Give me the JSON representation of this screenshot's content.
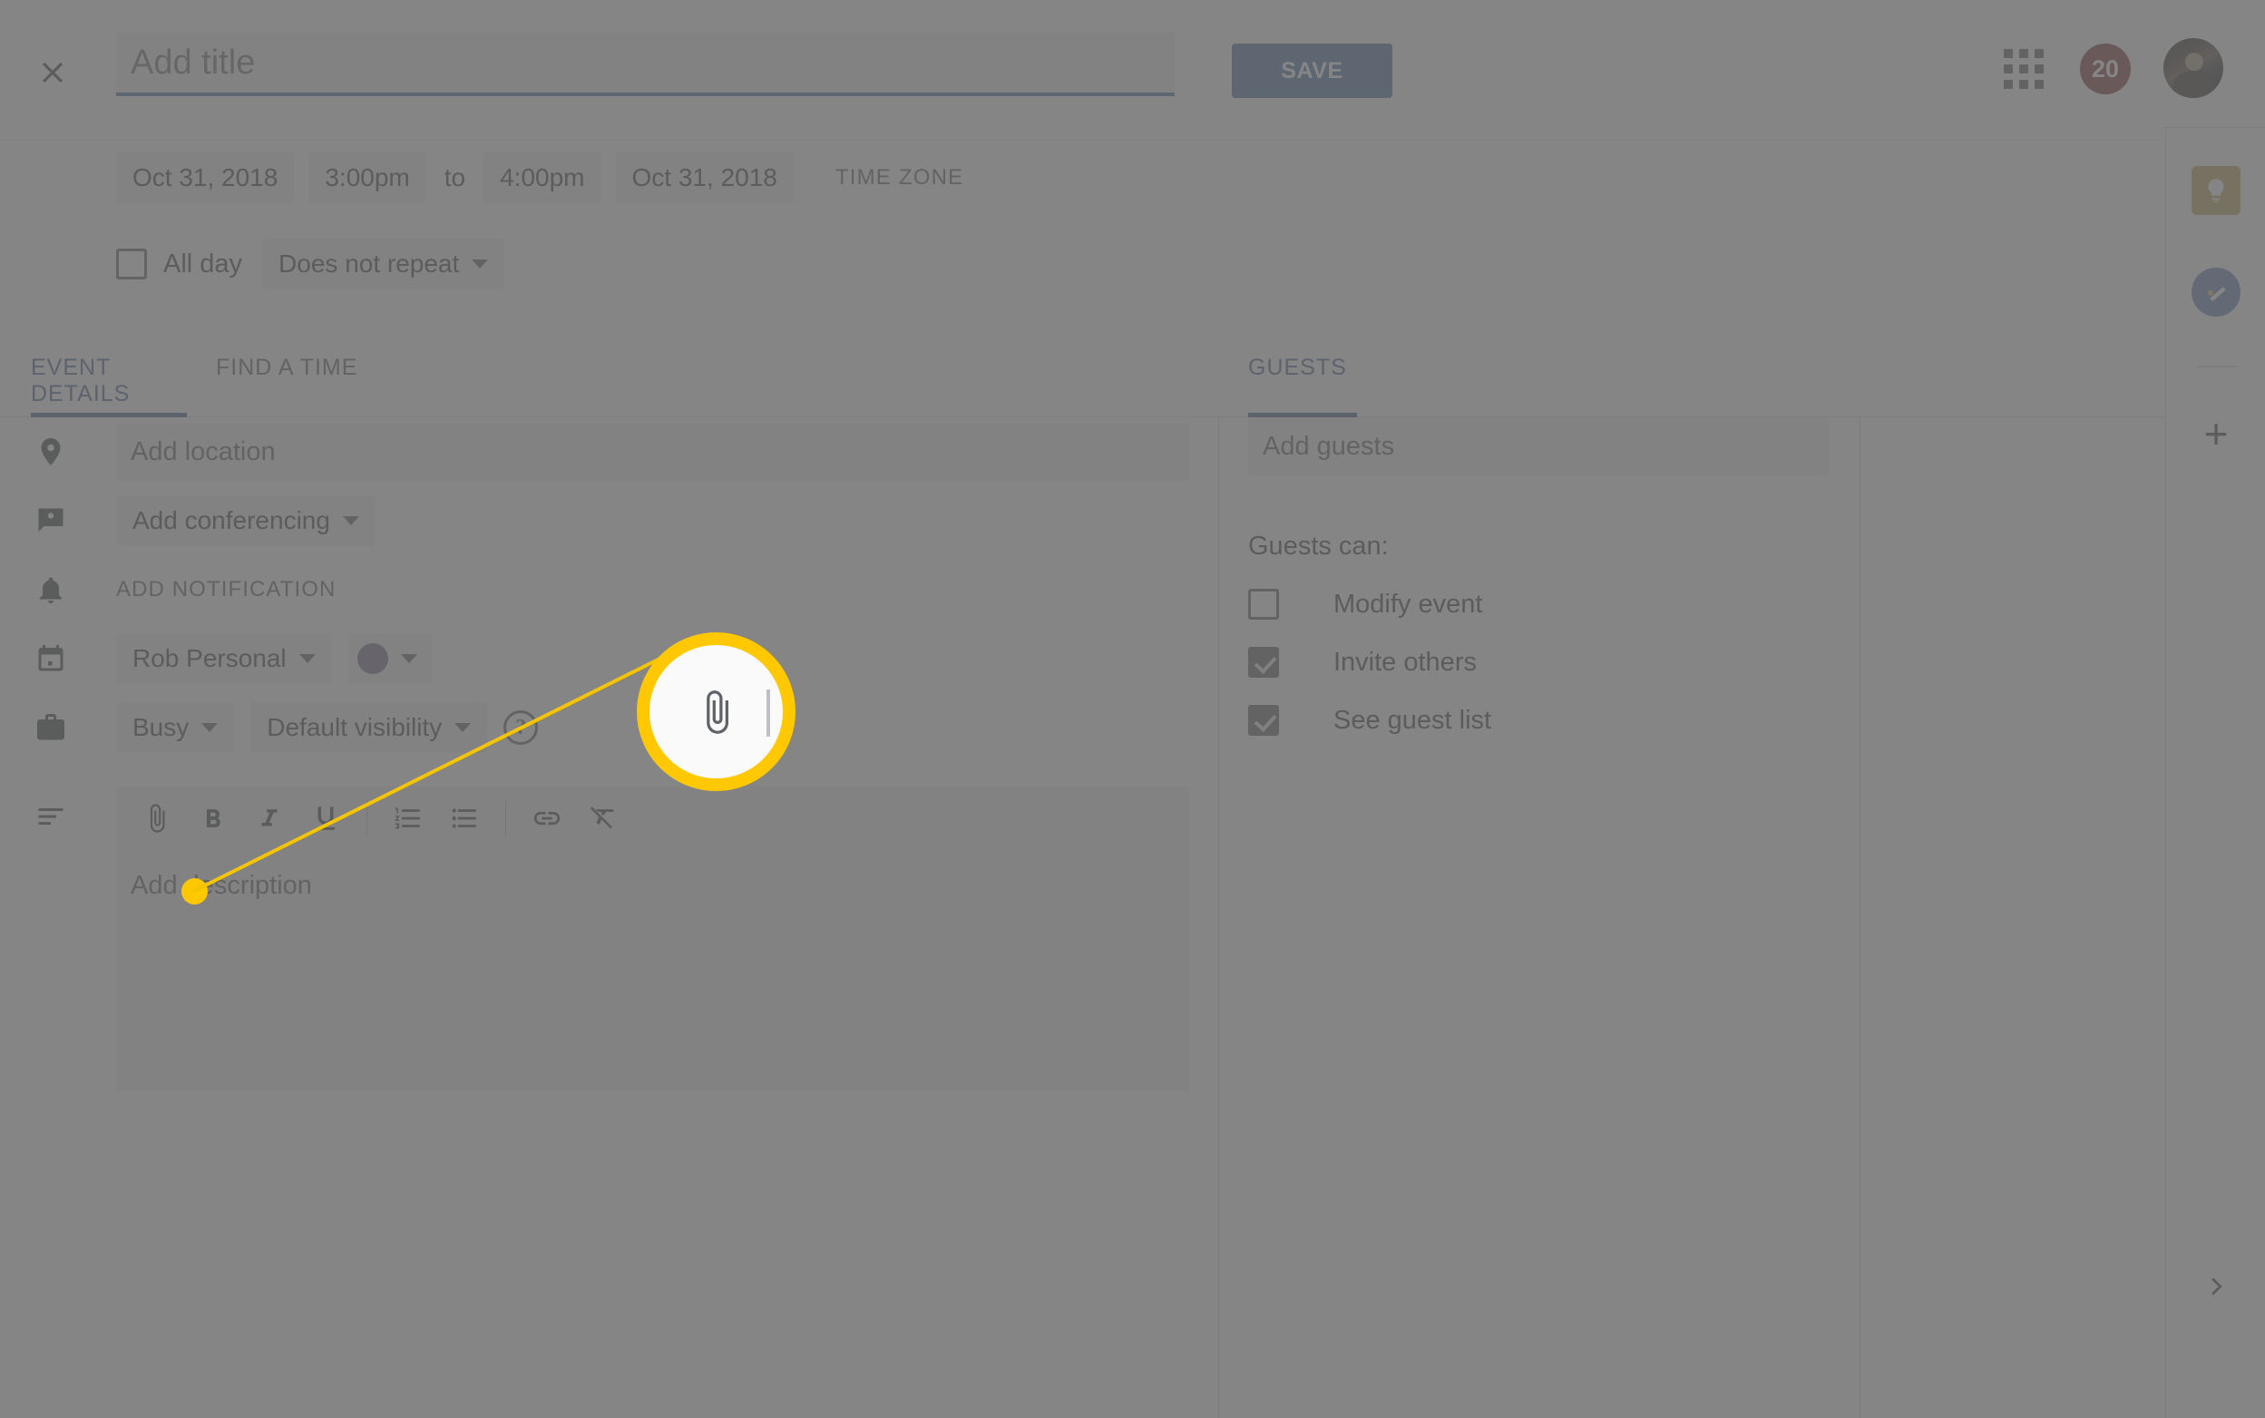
{
  "topbar": {
    "close_icon": "close-icon",
    "title_placeholder": "Add title",
    "title_value": "",
    "save_label": "SAVE",
    "apps_icon": "apps-grid-icon",
    "notification_count": "20",
    "avatar_icon": "user-avatar"
  },
  "schedule": {
    "start_date": "Oct 31, 2018",
    "start_time": "3:00pm",
    "to_label": "to",
    "end_time": "4:00pm",
    "end_date": "Oct 31, 2018",
    "timezone_label": "TIME ZONE",
    "all_day_label": "All day",
    "all_day_checked": false,
    "repeat_label": "Does not repeat"
  },
  "tabs": [
    {
      "id": "event-details",
      "label": "EVENT DETAILS",
      "active": true
    },
    {
      "id": "find-a-time",
      "label": "FIND A TIME",
      "active": false
    },
    {
      "id": "guests",
      "label": "GUESTS",
      "active": true
    }
  ],
  "details": {
    "location": {
      "icon": "location-pin-icon",
      "placeholder": "Add location",
      "value": ""
    },
    "conferencing": {
      "icon": "video-conference-icon",
      "label": "Add conferencing"
    },
    "notification": {
      "icon": "bell-icon",
      "label": "ADD NOTIFICATION"
    },
    "calendar": {
      "icon": "calendar-icon",
      "label": "Rob Personal",
      "color_hex": "#7b61b5"
    },
    "availability": {
      "icon": "briefcase-icon",
      "label": "Busy"
    },
    "visibility": {
      "label": "Default visibility",
      "help_icon": "help-question-icon",
      "help_glyph": "?"
    },
    "description": {
      "icon": "description-lines-icon",
      "placeholder": "Add description",
      "value": "",
      "toolbar": [
        {
          "id": "attach",
          "icon": "paperclip-icon",
          "label": "Add attachment"
        },
        {
          "id": "bold",
          "icon": "bold-icon",
          "label": "B"
        },
        {
          "id": "italic",
          "icon": "italic-icon",
          "label": "I"
        },
        {
          "id": "underline",
          "icon": "underline-icon",
          "label": "U"
        },
        {
          "id": "numbered-list",
          "icon": "numbered-list-icon",
          "label": "Numbered list"
        },
        {
          "id": "bulleted-list",
          "icon": "bulleted-list-icon",
          "label": "Bulleted list"
        },
        {
          "id": "link",
          "icon": "link-icon",
          "label": "Insert link"
        },
        {
          "id": "clear-format",
          "icon": "clear-formatting-icon",
          "label": "Remove formatting"
        }
      ]
    }
  },
  "guests": {
    "input_placeholder": "Add guests",
    "input_value": "",
    "permissions_label": "Guests can:",
    "permissions": [
      {
        "id": "modify-event",
        "label": "Modify event",
        "checked": false
      },
      {
        "id": "invite-others",
        "label": "Invite others",
        "checked": true
      },
      {
        "id": "see-guest-list",
        "label": "See guest list",
        "checked": true
      }
    ]
  },
  "right_rail": {
    "items": [
      {
        "id": "keep",
        "icon": "google-keep-icon",
        "color_hex": "#e0a400"
      },
      {
        "id": "tasks",
        "icon": "google-tasks-icon",
        "color_hex": "#4285f4"
      },
      {
        "id": "add-addon",
        "icon": "plus-icon",
        "glyph": "+"
      }
    ],
    "expand_icon": "chevron-right-icon"
  },
  "callout": {
    "highlight_icon": "paperclip-icon",
    "highlight_color_hex": "#ffc800"
  }
}
